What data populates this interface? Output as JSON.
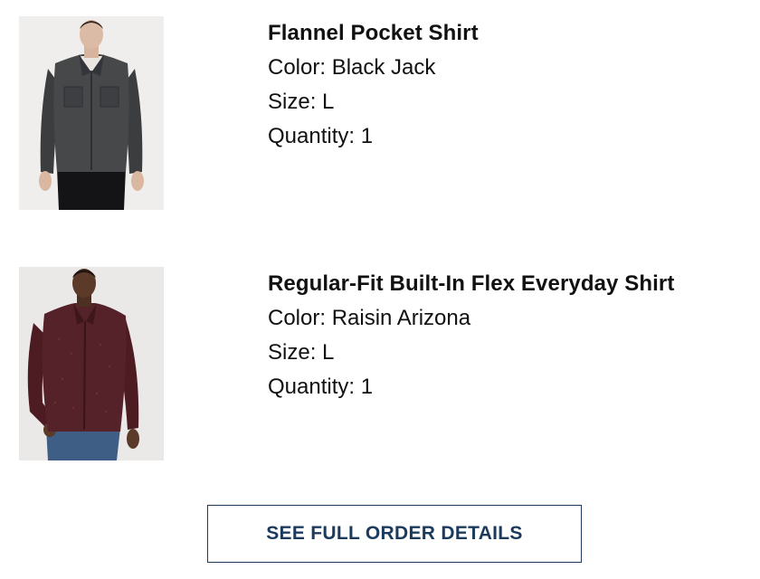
{
  "items": [
    {
      "image_icon": "product-photo-flannel-shirt",
      "name": "Flannel Pocket Shirt",
      "color_line": "Color: Black Jack",
      "size_line": "Size: L",
      "quantity_line": "Quantity: 1"
    },
    {
      "image_icon": "product-photo-everyday-shirt",
      "name": "Regular-Fit Built-In Flex Everyday Shirt",
      "color_line": "Color: Raisin Arizona",
      "size_line": "Size: L",
      "quantity_line": "Quantity: 1"
    }
  ],
  "cta": {
    "label": "SEE FULL ORDER DETAILS"
  },
  "colors": {
    "cta_border": "#1b3a5c",
    "cta_text": "#1b3a5c",
    "text": "#111111"
  }
}
